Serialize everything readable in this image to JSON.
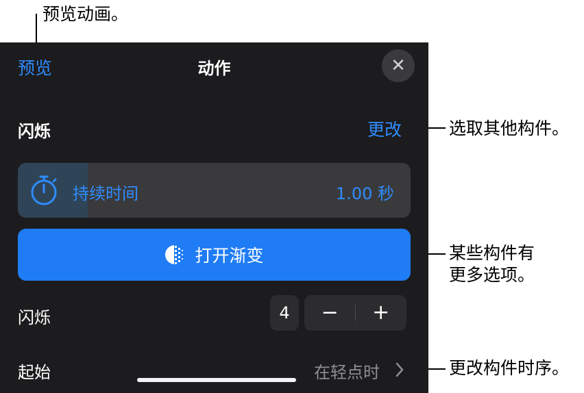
{
  "annotations": {
    "preview_callout": "预览动画。",
    "change_callout": "选取其他构件。",
    "options_callout_line1": "某些构件有",
    "options_callout_line2": "更多选项。",
    "order_callout": "更改构件时序。"
  },
  "header": {
    "preview_label": "预览",
    "title": "动作",
    "close_icon": "close-icon"
  },
  "effect": {
    "name": "闪烁",
    "change_label": "更改"
  },
  "duration": {
    "label": "持续时间",
    "value": "1.00 秒",
    "icon": "stopwatch-icon"
  },
  "fade_button": {
    "label": "打开渐变",
    "icon": "fade-icon"
  },
  "blink_count": {
    "label": "闪烁",
    "value": "4",
    "minus": "−",
    "plus": "+"
  },
  "start": {
    "label": "起始",
    "value": "在轻点时"
  },
  "colors": {
    "accent": "#2f8cff",
    "panel_background": "#1c1c1e",
    "row_background": "#3a3a3c",
    "fade_button": "#1f7cf5"
  }
}
